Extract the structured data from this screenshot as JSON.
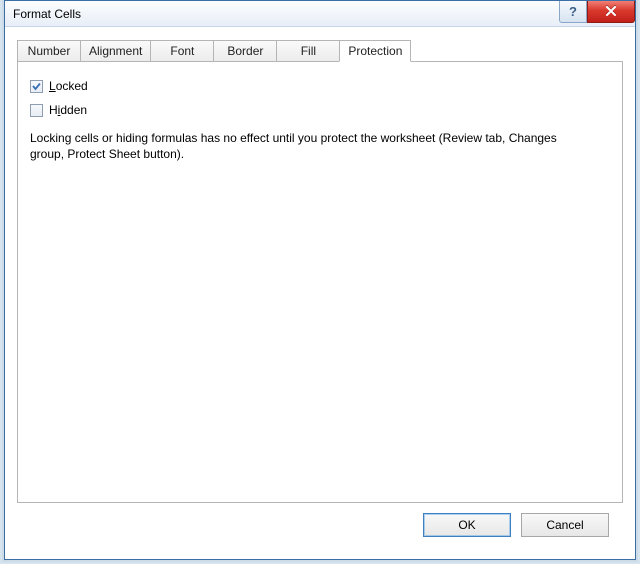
{
  "window": {
    "title": "Format Cells",
    "help_label": "?",
    "close_label": "×"
  },
  "tabs": [
    {
      "label": "Number"
    },
    {
      "label": "Alignment"
    },
    {
      "label": "Font"
    },
    {
      "label": "Border"
    },
    {
      "label": "Fill"
    },
    {
      "label": "Protection"
    }
  ],
  "active_tab_index": 5,
  "protection": {
    "locked": {
      "label": "Locked",
      "accel": "L",
      "checked": true
    },
    "hidden": {
      "label": "Hidden",
      "accel": "i",
      "checked": false
    },
    "description": "Locking cells or hiding formulas has no effect until you protect the worksheet (Review tab, Changes group, Protect Sheet button)."
  },
  "buttons": {
    "ok": "OK",
    "cancel": "Cancel"
  },
  "annotation": {
    "arrow_color": "#1c2e7b"
  }
}
